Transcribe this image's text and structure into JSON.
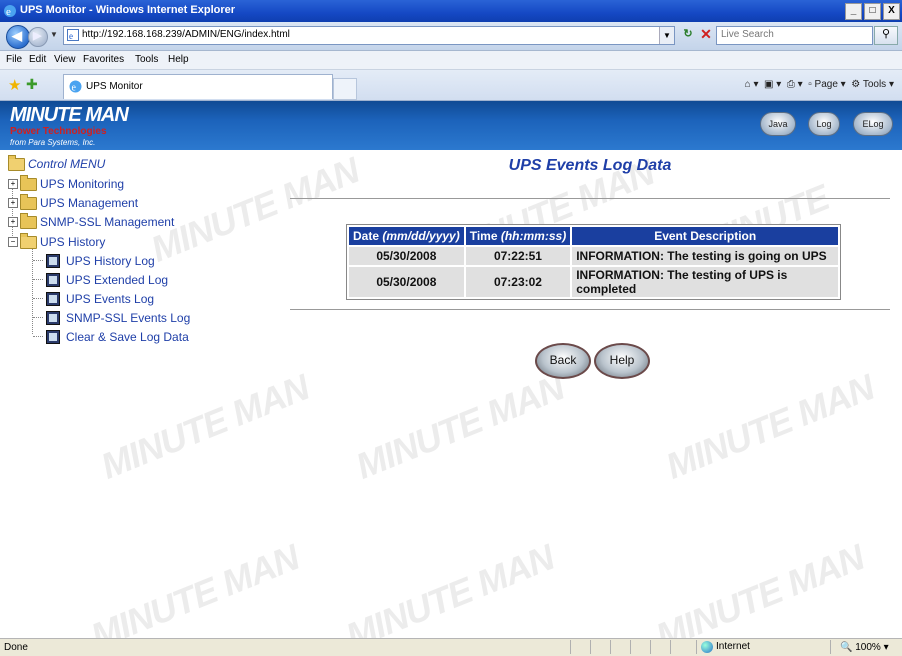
{
  "window": {
    "title": "UPS Monitor - Windows Internet Explorer",
    "controls": [
      "_",
      "□",
      "X"
    ]
  },
  "address_bar": {
    "url": "http://192.168.168.239/ADMIN/ENG/index.html",
    "search_placeholder": "Live Search"
  },
  "menu": [
    "File",
    "Edit",
    "View",
    "Favorites",
    "Tools",
    "Help"
  ],
  "tab": {
    "title": "UPS Monitor"
  },
  "command_bar": {
    "page_label": "Page",
    "tools_label": "Tools"
  },
  "banner": {
    "logo_top": "MINUTE MAN",
    "logo_sub": "Power Technologies",
    "logo_tag": "from Para Systems, Inc.",
    "buttons": [
      "Java",
      "Log",
      "ELog"
    ]
  },
  "tree": {
    "root": "Control MENU",
    "items": [
      "UPS Monitoring",
      "UPS Management",
      "SNMP-SSL Management",
      "UPS History"
    ],
    "history_children": [
      "UPS History Log",
      "UPS Extended Log",
      "UPS Events Log",
      "SNMP-SSL Events Log",
      "Clear & Save Log Data"
    ]
  },
  "content": {
    "heading": "UPS Events Log Data",
    "columns": {
      "date_prefix": "Date",
      "date_fmt": "(mm/dd/yyyy)",
      "time_prefix": "Time",
      "time_fmt": "(hh:mm:ss)",
      "event": "Event Description"
    },
    "rows": [
      {
        "date": "05/30/2008",
        "time": "07:22:51",
        "event": "INFORMATION: The testing is going on UPS"
      },
      {
        "date": "05/30/2008",
        "time": "07:23:02",
        "event": "INFORMATION: The testing of UPS is completed"
      }
    ],
    "back_label": "Back",
    "help_label": "Help"
  },
  "status": {
    "text": "Done",
    "zone": "Internet",
    "zoom": "100%"
  },
  "watermark": "MINUTE MAN"
}
